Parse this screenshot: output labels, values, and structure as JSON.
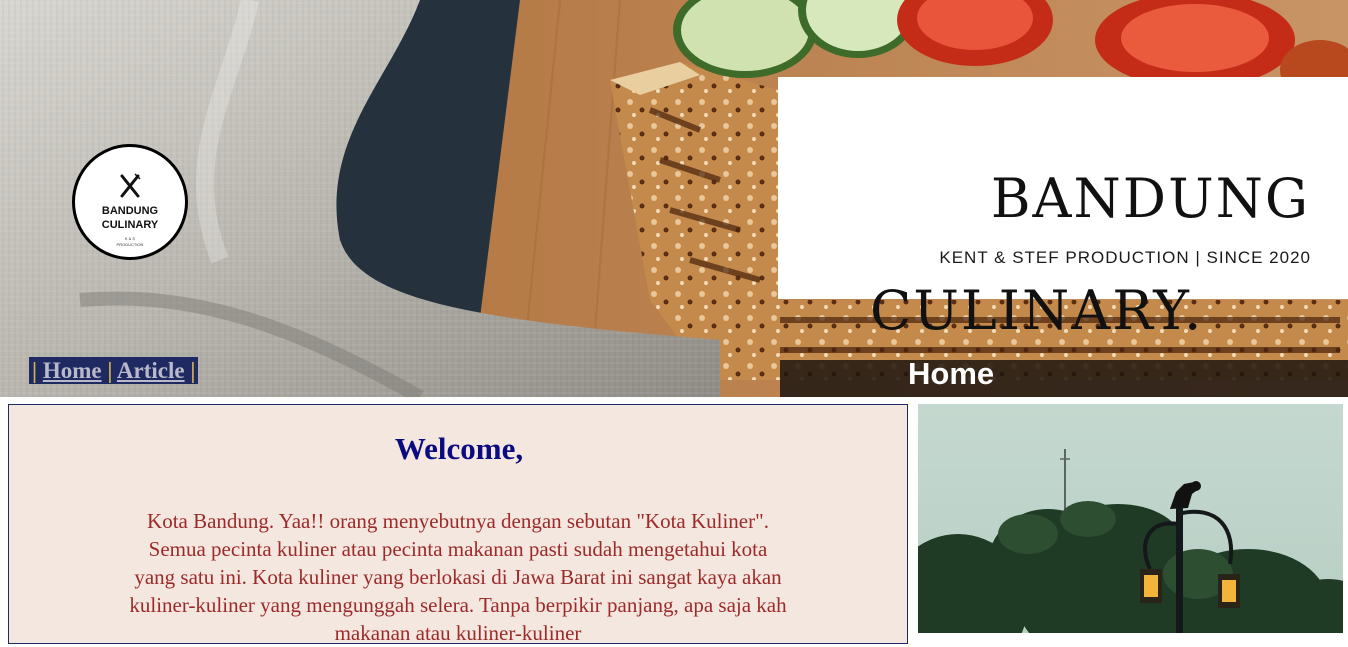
{
  "logo": {
    "line1": "BANDUNG",
    "line2": "CULINARY",
    "line3": "K & S",
    "line4": "PRODUCTION",
    "icon": "fork-and-knife-icon"
  },
  "brand": {
    "title_line1": "BANDUNG",
    "title_line2": "CULINARY.",
    "subtitle": "KENT & STEF PRODUCTION | SINCE 2020"
  },
  "nav": {
    "items": [
      {
        "label": "Home"
      },
      {
        "label": "Article"
      }
    ],
    "separator": "|"
  },
  "page": {
    "heading": "Home"
  },
  "welcome": {
    "title": "Welcome,",
    "body": "Kota Bandung. Yaa!! orang menyebutnya dengan sebutan \"Kota Kuliner\". Semua pecinta kuliner atau pecinta makanan pasti sudah mengetahui kota yang satu ini. Kota kuliner yang berlokasi di Jawa Barat ini sangat kaya akan kuliner-kuliner yang mengunggah selera. Tanpa berpikir panjang, apa saja kah makanan atau kuliner-kuliner"
  },
  "colors": {
    "nav_bg": "#1f2a63",
    "welcome_bg": "#f4e7df",
    "welcome_title": "#0b0b80",
    "welcome_text": "#9c2a2a"
  }
}
